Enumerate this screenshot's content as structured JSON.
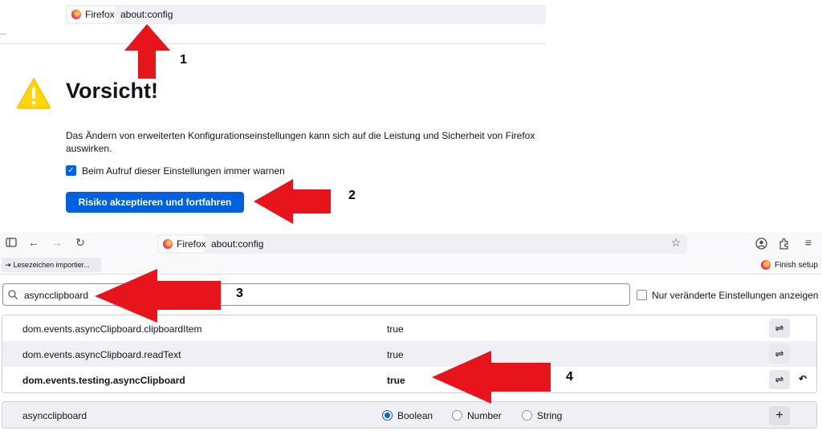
{
  "top": {
    "identity_label": "Firefox",
    "url": "about:config",
    "ellipsis": "...",
    "title": "Vorsicht!",
    "description": "Das Ändern von erweiterten Konfigurationseinstellungen kann sich auf die Leistung und Sicherheit von Firefox auswirken.",
    "warn_checkbox_checked": true,
    "warn_checkbox_label": "Beim Aufruf dieser Einstellungen immer warnen",
    "accept_button": "Risiko akzeptieren und fortfahren"
  },
  "browser": {
    "identity_label": "Firefox",
    "url": "about:config",
    "bookmarks": {
      "import_label": "Lesezeichen importier...",
      "finish_label": "Finish setup"
    }
  },
  "config": {
    "search_value": "asyncclipboard",
    "modified_only_label": "Nur veränderte Einstellungen anzeigen",
    "modified_only_checked": false,
    "prefs": [
      {
        "name": "dom.events.asyncClipboard.clipboardItem",
        "value": "true",
        "modified": false
      },
      {
        "name": "dom.events.asyncClipboard.readText",
        "value": "true",
        "modified": false
      },
      {
        "name": "dom.events.testing.asyncClipboard",
        "value": "true",
        "modified": true
      }
    ],
    "new_pref": {
      "name": "asyncclipboard",
      "types": [
        "Boolean",
        "Number",
        "String"
      ],
      "selected_type": "Boolean"
    }
  },
  "annotations": {
    "arrow_color": "#e8141c",
    "steps": [
      "1",
      "2",
      "3",
      "4"
    ]
  },
  "colors": {
    "accent": "#0061e0",
    "warning": "#ffd60a"
  }
}
